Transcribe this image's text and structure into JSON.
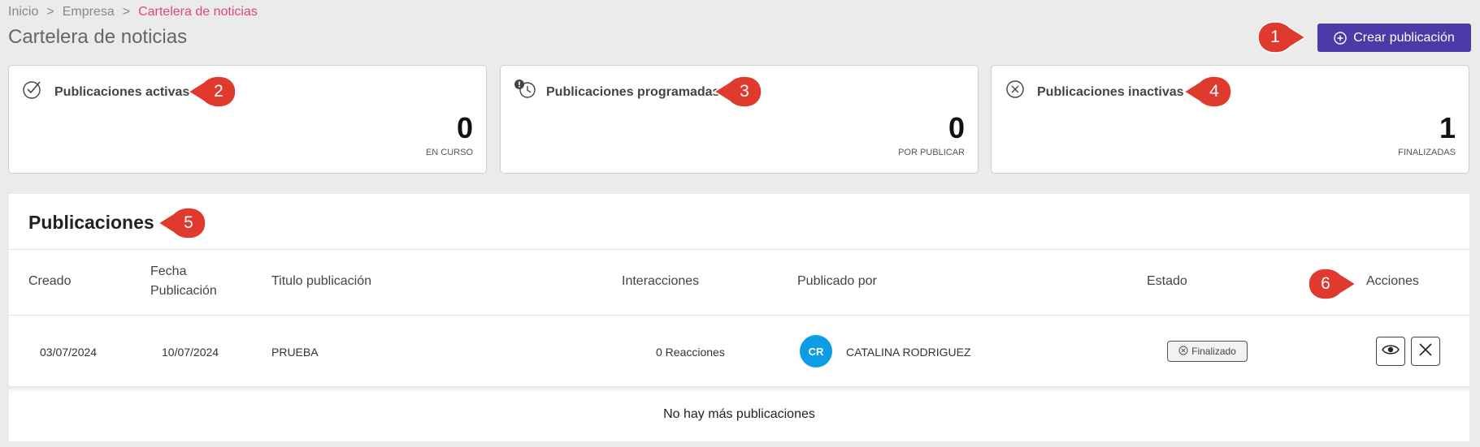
{
  "breadcrumb": {
    "items": [
      "Inicio",
      "Empresa",
      "Cartelera de noticias"
    ],
    "separator": ">"
  },
  "page_title": "Cartelera de noticias",
  "create_button": {
    "label": "Crear publicación",
    "icon": "plus-circle-icon",
    "color": "#4b3aa8"
  },
  "markers": {
    "color": "#e03a2f",
    "labels": [
      "1",
      "2",
      "3",
      "4",
      "5",
      "6"
    ]
  },
  "cards": [
    {
      "icon": "check-circle-icon",
      "title": "Publicaciones activas",
      "value": "0",
      "subtitle": "EN CURSO"
    },
    {
      "icon": "clock-alert-icon",
      "title": "Publicaciones programadas",
      "value": "0",
      "subtitle": "POR PUBLICAR"
    },
    {
      "icon": "x-circle-icon",
      "title": "Publicaciones inactivas",
      "value": "1",
      "subtitle": "FINALIZADAS"
    }
  ],
  "publications": {
    "title": "Publicaciones",
    "columns": {
      "created": "Creado",
      "published_line1": "Fecha",
      "published_line2": "Publicación",
      "title": "Titulo publicación",
      "interactions": "Interacciones",
      "author": "Publicado por",
      "status": "Estado",
      "actions": "Acciones"
    },
    "rows": [
      {
        "created": "03/07/2024",
        "published": "10/07/2024",
        "title": "PRUEBA",
        "interactions": "0 Reacciones",
        "author_initials": "CR",
        "author": "CATALINA RODRIGUEZ",
        "status": "Finalizado"
      }
    ],
    "footer": "No hay más publicaciones"
  }
}
